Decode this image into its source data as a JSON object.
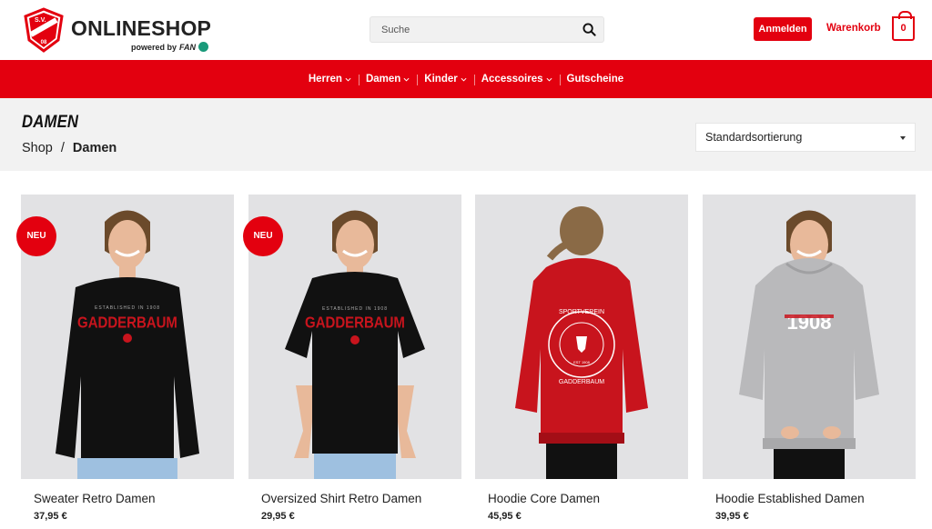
{
  "header": {
    "brand_title": "ONLINESHOP",
    "brand_sub_prefix": "powered by",
    "brand_sub_fan": "FAN",
    "crest_text": "S.V. GADDERBAUM 08",
    "search_placeholder": "Suche",
    "login_label": "Anmelden",
    "cart_label": "Warenkorb",
    "cart_count": "0"
  },
  "nav": {
    "items": [
      {
        "label": "Herren",
        "has_dropdown": true
      },
      {
        "label": "Damen",
        "has_dropdown": true
      },
      {
        "label": "Kinder",
        "has_dropdown": true
      },
      {
        "label": "Accessoires",
        "has_dropdown": true
      },
      {
        "label": "Gutscheine",
        "has_dropdown": false
      }
    ]
  },
  "page": {
    "title": "DAMEN",
    "breadcrumb": [
      "Shop",
      "/",
      "Damen"
    ],
    "sort_selected": "Standardsortierung"
  },
  "products": [
    {
      "name": "Sweater Retro Damen",
      "price": "37,95 €",
      "badge": "NEU",
      "garment": "sweater",
      "color": "#111111"
    },
    {
      "name": "Oversized Shirt Retro Damen",
      "price": "29,95 €",
      "badge": "NEU",
      "garment": "shirt",
      "color": "#111111"
    },
    {
      "name": "Hoodie Core Damen",
      "price": "45,95 €",
      "badge": "",
      "garment": "hoodie-back",
      "color": "#c8141d"
    },
    {
      "name": "Hoodie Established Damen",
      "price": "39,95 €",
      "badge": "",
      "garment": "hoodie",
      "color": "#b9b9bb"
    }
  ],
  "colors": {
    "accent": "#e3000f",
    "title_bg": "#f2f2f2",
    "product_bg": "#e2e2e4"
  },
  "product_prints": {
    "sweater": [
      "ESTABLISHED IN 1908",
      "GADDERBAUM"
    ],
    "shirt": [
      "ESTABLISHED IN 1908",
      "GADDERBAUM"
    ],
    "hoodie-back": [
      "SPORTVEREIN",
      "GADDERBAUM",
      "EST 1908"
    ],
    "hoodie": [
      "1908"
    ]
  }
}
